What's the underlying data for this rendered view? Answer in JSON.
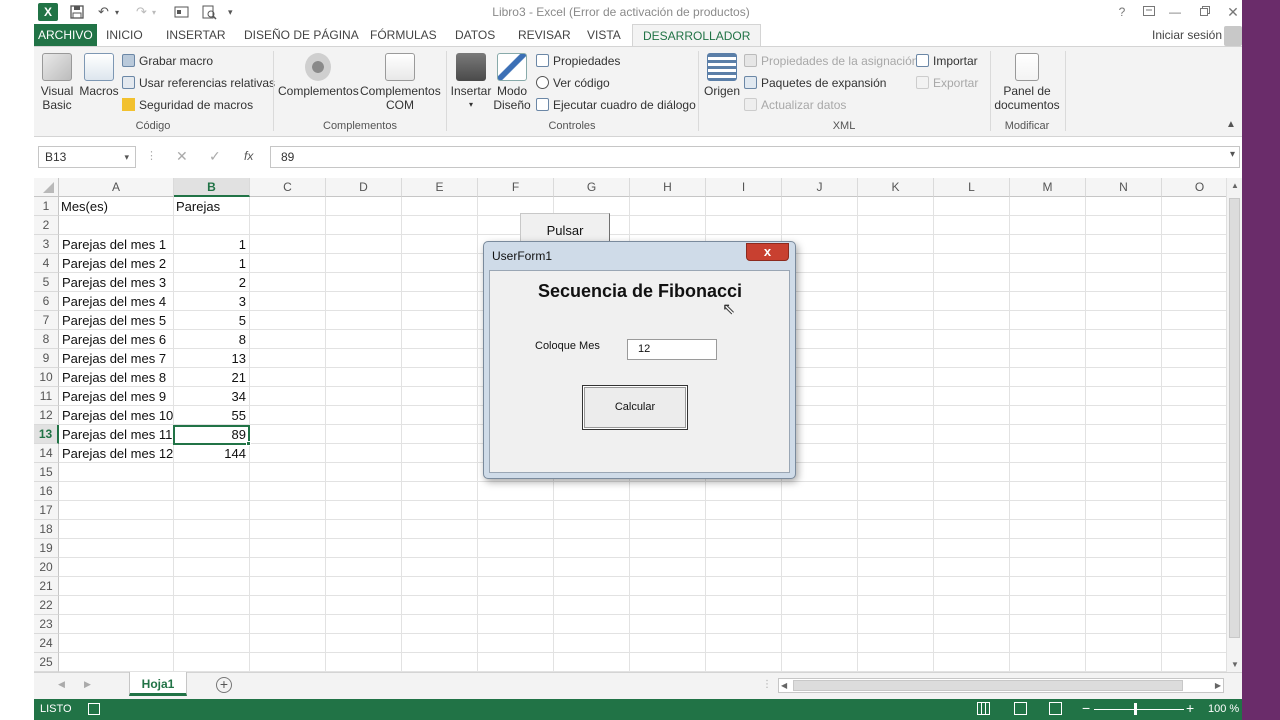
{
  "window": {
    "title": "Libro3 - Excel (Error de activación de productos)",
    "help": "?",
    "signin": "Iniciar sesión"
  },
  "tabs": [
    "ARCHIVO",
    "INICIO",
    "INSERTAR",
    "DISEÑO DE PÁGINA",
    "FÓRMULAS",
    "DATOS",
    "REVISAR",
    "VISTA",
    "DESARROLLADOR"
  ],
  "ribbon": {
    "codigo": {
      "visual_basic": "Visual Basic",
      "macros": "Macros",
      "grabar": "Grabar macro",
      "relativas": "Usar referencias relativas",
      "seguridad": "Seguridad de macros",
      "label": "Código"
    },
    "complementos": {
      "complementos": "Complementos",
      "com": "Complementos COM",
      "label": "Complementos"
    },
    "controles": {
      "insertar": "Insertar",
      "modo": "Modo Diseño",
      "propiedades": "Propiedades",
      "ver_codigo": "Ver código",
      "ejecutar": "Ejecutar cuadro de diálogo",
      "label": "Controles"
    },
    "xml": {
      "origen": "Origen",
      "prop_asig": "Propiedades de la asignación",
      "paquetes": "Paquetes de expansión",
      "actualizar": "Actualizar datos",
      "importar": "Importar",
      "exportar": "Exportar",
      "label": "XML"
    },
    "modificar": {
      "panel": "Panel de documentos",
      "label": "Modificar"
    }
  },
  "formula_bar": {
    "name_box": "B13",
    "fx": "fx",
    "value": "89"
  },
  "columns": [
    "A",
    "B",
    "C",
    "D",
    "E",
    "F",
    "G",
    "H",
    "I",
    "J",
    "K",
    "L",
    "M",
    "N",
    "O"
  ],
  "rows": [
    "1",
    "2",
    "3",
    "4",
    "5",
    "6",
    "7",
    "8",
    "9",
    "10",
    "11",
    "12",
    "13",
    "14",
    "15",
    "16",
    "17",
    "18",
    "19",
    "20",
    "21",
    "22",
    "23",
    "24",
    "25"
  ],
  "cells": {
    "header_a": "Mes(es)",
    "header_b": "Parejas",
    "data": [
      {
        "month": "Parejas del mes 1",
        "value": "1"
      },
      {
        "month": "Parejas del mes 2",
        "value": "1"
      },
      {
        "month": "Parejas del mes 3",
        "value": "2"
      },
      {
        "month": "Parejas del mes 4",
        "value": "3"
      },
      {
        "month": "Parejas del mes 5",
        "value": "5"
      },
      {
        "month": "Parejas del mes 6",
        "value": "8"
      },
      {
        "month": "Parejas del mes 7",
        "value": "13"
      },
      {
        "month": "Parejas del mes 8",
        "value": "21"
      },
      {
        "month": "Parejas del mes 9",
        "value": "34"
      },
      {
        "month": "Parejas del mes 10",
        "value": "55"
      },
      {
        "month": "Parejas del mes 11",
        "value": "89"
      },
      {
        "month": "Parejas del mes 12",
        "value": "144"
      }
    ]
  },
  "pulsar_button": "Pulsar",
  "sheet_tab": "Hoja1",
  "status": {
    "ready": "LISTO",
    "zoom": "100 %"
  },
  "userform": {
    "title": "UserForm1",
    "close": "x",
    "heading": "Secuencia de Fibonacci",
    "label": "Coloque Mes",
    "input_value": "12",
    "button": "Calcular"
  },
  "colors": {
    "accent": "#217346",
    "close_button": "#c84030"
  }
}
